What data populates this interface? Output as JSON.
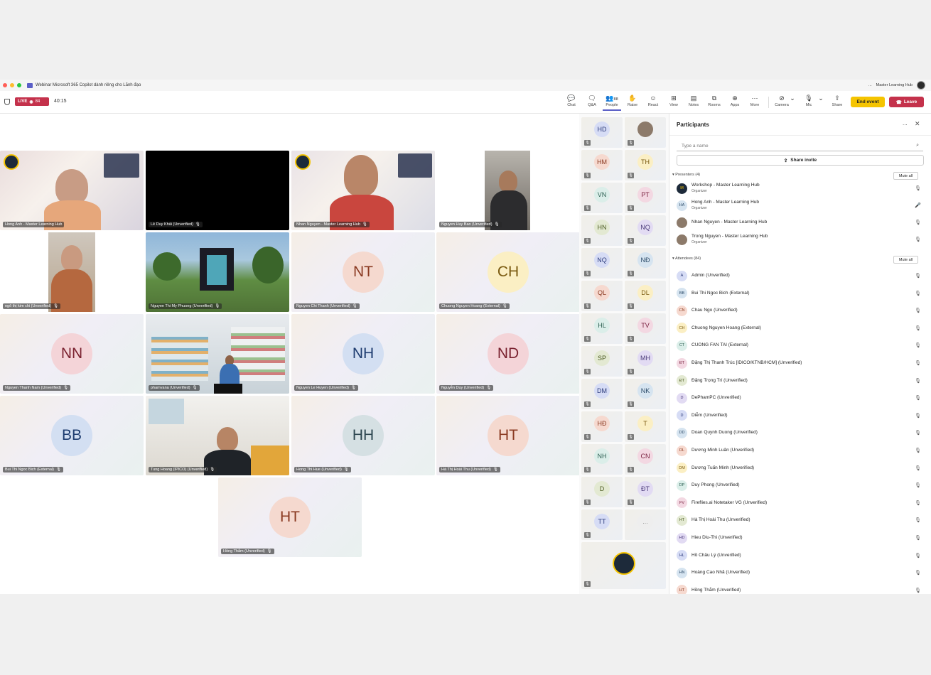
{
  "window": {
    "title": "Webinar Microsoft 365 Copilot dành riêng cho Lãnh đạo",
    "more": "...",
    "org_name": "Master Learning Hub"
  },
  "toolbar": {
    "live_label": "LIVE",
    "viewer_count": "84",
    "timer": "40:15",
    "people_count": "88",
    "buttons": [
      {
        "label": "Chat",
        "icon": "chat-icon"
      },
      {
        "label": "Q&A",
        "icon": "qa-icon"
      },
      {
        "label": "People",
        "icon": "people-icon"
      },
      {
        "label": "Raise",
        "icon": "hand-icon"
      },
      {
        "label": "React",
        "icon": "smile-icon"
      },
      {
        "label": "View",
        "icon": "grid-icon"
      },
      {
        "label": "Notes",
        "icon": "notes-icon"
      },
      {
        "label": "Rooms",
        "icon": "rooms-icon"
      },
      {
        "label": "Apps",
        "icon": "apps-icon"
      },
      {
        "label": "More",
        "icon": "more-icon"
      },
      {
        "label": "Camera",
        "icon": "camera-off-icon"
      },
      {
        "label": "Mic",
        "icon": "mic-off-icon"
      },
      {
        "label": "Share",
        "icon": "share-icon"
      }
    ],
    "end_event": "End event",
    "leave": "Leave"
  },
  "stage": {
    "tiles": [
      {
        "name": "Hong Anh - Master Learning Hub",
        "initials": ""
      },
      {
        "name": "Lê Duy Khải (Unverified)",
        "initials": ""
      },
      {
        "name": "Nhan Nguyen - Master Learning Hub",
        "initials": ""
      },
      {
        "name": "Nguyen Huy Bao (Unverified)",
        "initials": ""
      },
      {
        "name": "ngô thị kim chi (Unverified)",
        "initials": ""
      },
      {
        "name": "Nguyen Thi My Phuong (Unverified)",
        "initials": ""
      },
      {
        "name": "Nguyen Chi Thanh (Unverified)",
        "initials": "NT"
      },
      {
        "name": "Chuong Nguyen Hoang (External)",
        "initials": "CH"
      },
      {
        "name": "Nguyen Thanh Nam (Unverified)",
        "initials": "NN"
      },
      {
        "name": "phamvana (Unverified)",
        "initials": ""
      },
      {
        "name": "Nguyen Le Huyen (Unverified)",
        "initials": "NH"
      },
      {
        "name": "Nguyễn Duy (Unverified)",
        "initials": "ND"
      },
      {
        "name": "Bui Thi Ngoc Bich (External)",
        "initials": "BB"
      },
      {
        "name": "Tung Hoang (IPICO) (Unverified)",
        "initials": ""
      },
      {
        "name": "Hong Thi Hue (Unverified)",
        "initials": "HH"
      },
      {
        "name": "Hà Thị Hoài Thu (Unverified)",
        "initials": "HT"
      },
      {
        "name": "Hồng Thắm (Unverified)",
        "initials": "HT"
      }
    ],
    "colors": {
      "NT": [
        "#f5d9cf",
        "#8a3a22"
      ],
      "CH": [
        "#fbefc4",
        "#7a5a10"
      ],
      "NN": [
        "#f4d4d8",
        "#7a2230"
      ],
      "NH": [
        "#d3dff2",
        "#1f3d70"
      ],
      "ND": [
        "#f4d4d8",
        "#7a2230"
      ],
      "BB": [
        "#d3dff2",
        "#1f3d70"
      ],
      "HH": [
        "#d5e0e3",
        "#2d4650"
      ],
      "HT": [
        "#f5d9cf",
        "#8a3a22"
      ]
    }
  },
  "side_tiles": [
    "HD",
    "",
    "HM",
    "TH",
    "VN",
    "PT",
    "HN",
    "NQ",
    "NQ",
    "NĐ",
    "QL",
    "DL",
    "HL",
    "TV",
    "SP",
    "MH",
    "DM",
    "NK",
    "HĐ",
    "T",
    "NH",
    "CN",
    "D",
    "ĐT",
    "TT",
    "..."
  ],
  "panel": {
    "title": "Participants",
    "more": "...",
    "search_placeholder": "Type a name",
    "share_invite": "Share invite",
    "presenters_header": "Presenters (4)",
    "attendees_header": "Attendees (84)",
    "mute_all": "Mute all",
    "presenters": [
      {
        "name": "Workshop - Master Learning Hub",
        "role": "Organizer",
        "initials": "M"
      },
      {
        "name": "Hong Anh - Master Learning Hub",
        "role": "Organizer",
        "initials": "HA"
      },
      {
        "name": "Nhan Nguyen - Master Learning Hub",
        "role": "",
        "initials": ""
      },
      {
        "name": "Trong Nguyen - Master Learning Hub",
        "role": "Organizer",
        "initials": ""
      }
    ],
    "attendees": [
      {
        "name": "Admin (Unverified)",
        "initials": "A"
      },
      {
        "name": "Bui Thi Ngoc Bich (External)",
        "initials": "BB"
      },
      {
        "name": "Chau Ngo (Unverified)",
        "initials": "CN"
      },
      {
        "name": "Chuong Nguyen Hoang (External)",
        "initials": "CH"
      },
      {
        "name": "CUONG FAN TAI (External)",
        "initials": "CT"
      },
      {
        "name": "Đặng Thị Thanh Trúc [IDICO/KTNB/HCM] (Unverified)",
        "initials": "ĐT"
      },
      {
        "name": "Đặng Trọng Trí (Unverified)",
        "initials": "ĐT"
      },
      {
        "name": "DePhamPC (Unverified)",
        "initials": "D"
      },
      {
        "name": "Diễm (Unverified)",
        "initials": "D"
      },
      {
        "name": "Doan Quynh Duong (Unverified)",
        "initials": "DD"
      },
      {
        "name": "Dương Minh Luân (Unverified)",
        "initials": "DL"
      },
      {
        "name": "Dương Tuấn Minh (Unverified)",
        "initials": "DM"
      },
      {
        "name": "Duy Phong (Unverified)",
        "initials": "DP"
      },
      {
        "name": "Fireflies.ai Notetaker VG (Unverified)",
        "initials": "FV"
      },
      {
        "name": "Hà Thị Hoài Thu (Unverified)",
        "initials": "HT"
      },
      {
        "name": "Hieu Diu-Thi (Unverified)",
        "initials": "HD"
      },
      {
        "name": "Hồ Châu Lý (Unverified)",
        "initials": "HL"
      },
      {
        "name": "Hoàng Cao Nhã (Unverified)",
        "initials": "HN"
      },
      {
        "name": "Hồng Thắm (Unverified)",
        "initials": "HT"
      }
    ]
  },
  "palette": [
    "#d6dcf5",
    "#d6e4f0",
    "#f6d9cf",
    "#fbefc4",
    "#dbeee9",
    "#f3d8e2",
    "#e3e9d2",
    "#e2dbf3"
  ],
  "accent": "#5b5fc7",
  "live_color": "#c4314b",
  "end_color": "#f5c400"
}
